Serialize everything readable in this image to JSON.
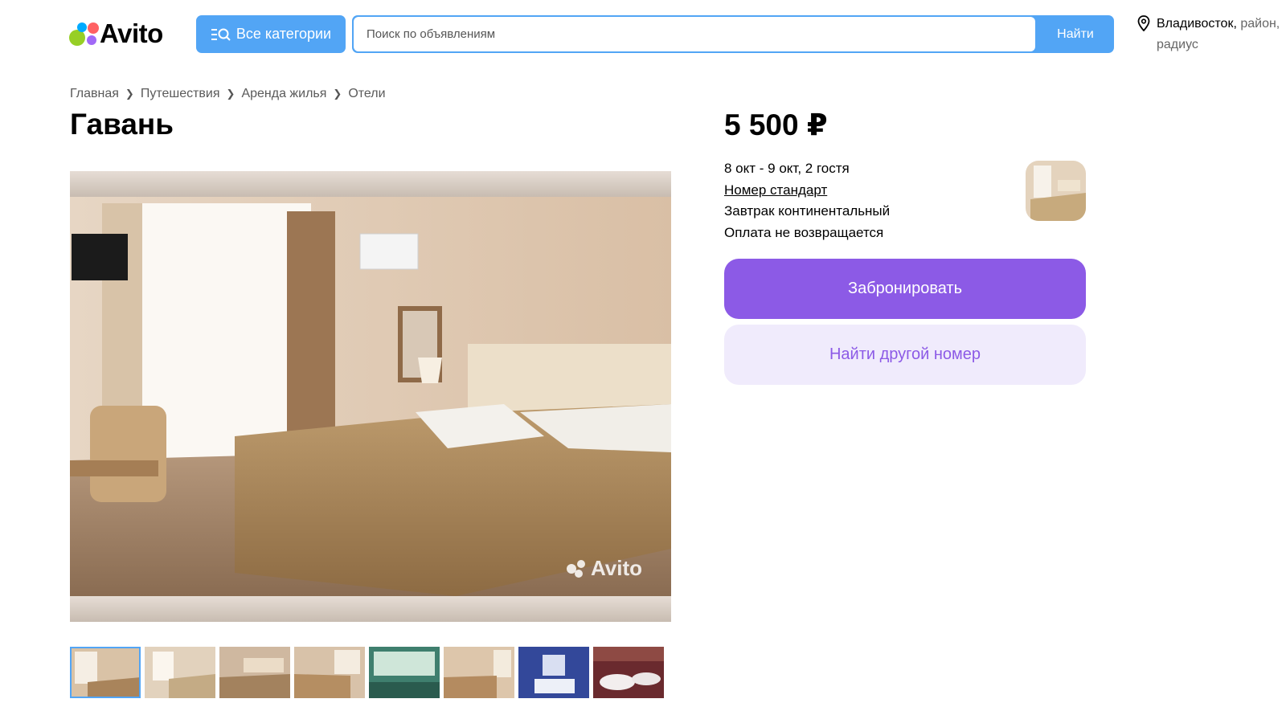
{
  "header": {
    "logo_text": "Avito",
    "categories_label": "Все категории",
    "search_placeholder": "Поиск по объявлениям",
    "search_button": "Найти",
    "location_city": "Владивосток,",
    "location_rest": " район, радиус"
  },
  "breadcrumb": [
    "Главная",
    "Путешествия",
    "Аренда жилья",
    "Отели"
  ],
  "listing": {
    "title": "Гавань",
    "price": "5 500 ₽",
    "dates_guests": "8 окт - 9 окт, 2 гостя",
    "room_type": "Номер стандарт",
    "meal": "Завтрак континентальный",
    "payment": "Оплата не возвращается",
    "photo_watermark": "Avito"
  },
  "actions": {
    "book": "Забронировать",
    "find_other": "Найти другой номер"
  },
  "colors": {
    "accent_blue": "#52a5f5",
    "book_purple": "#8c5ae6",
    "secondary_bg": "#f0ebfc"
  },
  "gallery": {
    "thumbnail_count": 8,
    "active_index": 0
  }
}
